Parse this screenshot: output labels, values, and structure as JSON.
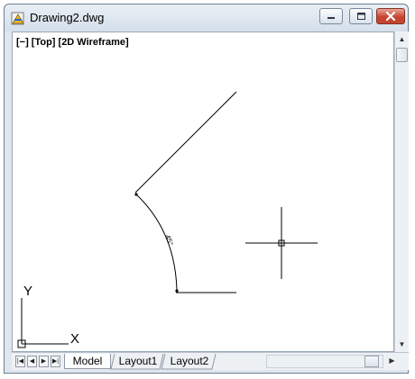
{
  "window": {
    "title": "Drawing2.dwg",
    "icon": "autocad-drawing-icon",
    "controls": [
      "minimize-icon",
      "maximize-icon",
      "close-icon"
    ]
  },
  "viewport": {
    "label": "[−] [Top] [2D Wireframe]",
    "dimension_text": "45°",
    "ucs_x_label": "X",
    "ucs_y_label": "Y"
  },
  "layout_tabs": [
    {
      "label": "Model",
      "active": true
    },
    {
      "label": "Layout1",
      "active": false
    },
    {
      "label": "Layout2",
      "active": false
    }
  ],
  "colors": {
    "titlebar": "#dbe4ee",
    "close_button": "#c7432f",
    "drawing_background": "#ffffff",
    "geometry": "#000000"
  }
}
